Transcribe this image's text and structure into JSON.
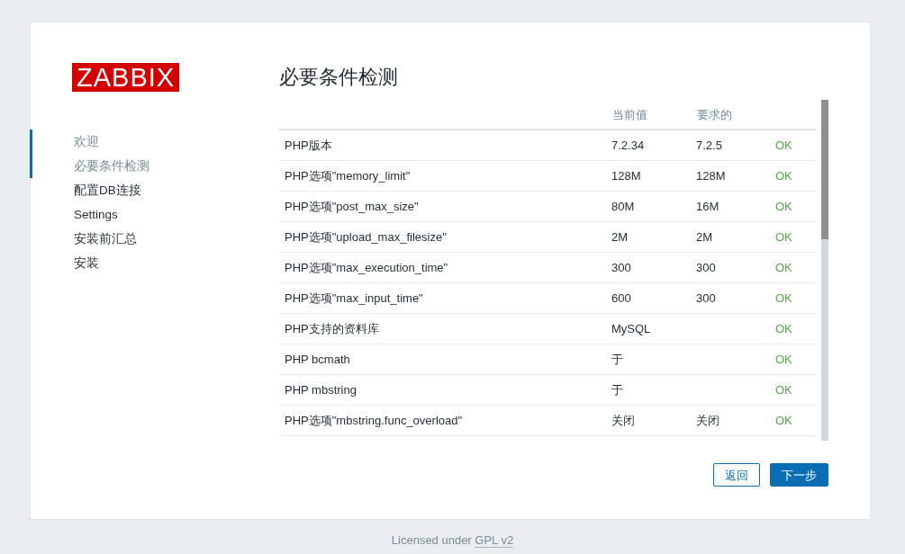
{
  "logo": {
    "text": "ZABBIX"
  },
  "steps": [
    {
      "label": "欢迎",
      "completed": true
    },
    {
      "label": "必要条件检测",
      "completed": true
    },
    {
      "label": "配置DB连接",
      "completed": false
    },
    {
      "label": "Settings",
      "completed": false
    },
    {
      "label": "安装前汇总",
      "completed": false
    },
    {
      "label": "安装",
      "completed": false
    }
  ],
  "title": "必要条件检测",
  "table": {
    "columns": [
      "当前值",
      "要求的"
    ],
    "rows": [
      {
        "name": "PHP版本",
        "current": "7.2.34",
        "required": "7.2.5",
        "result": "OK",
        "passed": true
      },
      {
        "name": "PHP选项\"memory_limit\"",
        "current": "128M",
        "required": "128M",
        "result": "OK",
        "passed": true
      },
      {
        "name": "PHP选项\"post_max_size\"",
        "current": "80M",
        "required": "16M",
        "result": "OK",
        "passed": true
      },
      {
        "name": "PHP选项\"upload_max_filesize\"",
        "current": "2M",
        "required": "2M",
        "result": "OK",
        "passed": true
      },
      {
        "name": "PHP选项\"max_execution_time\"",
        "current": "300",
        "required": "300",
        "result": "OK",
        "passed": true
      },
      {
        "name": "PHP选项\"max_input_time\"",
        "current": "600",
        "required": "300",
        "result": "OK",
        "passed": true
      },
      {
        "name": "PHP支持的资料库",
        "current": "MySQL",
        "result": "OK",
        "passed": true
      },
      {
        "name": "PHP bcmath",
        "current": "于",
        "result": "OK",
        "passed": true
      },
      {
        "name": "PHP mbstring",
        "current": "于",
        "result": "OK",
        "passed": true
      },
      {
        "name": "PHP选项\"mbstring.func_overload\"",
        "current": "关闭",
        "required": "关闭",
        "result": "OK",
        "passed": true
      }
    ]
  },
  "buttons": [
    {
      "label": "返回",
      "kind": "secondary"
    },
    {
      "label": "下一步",
      "kind": "primary"
    }
  ],
  "footer": {
    "text": "Licensed under",
    "link": "GPL v2"
  }
}
